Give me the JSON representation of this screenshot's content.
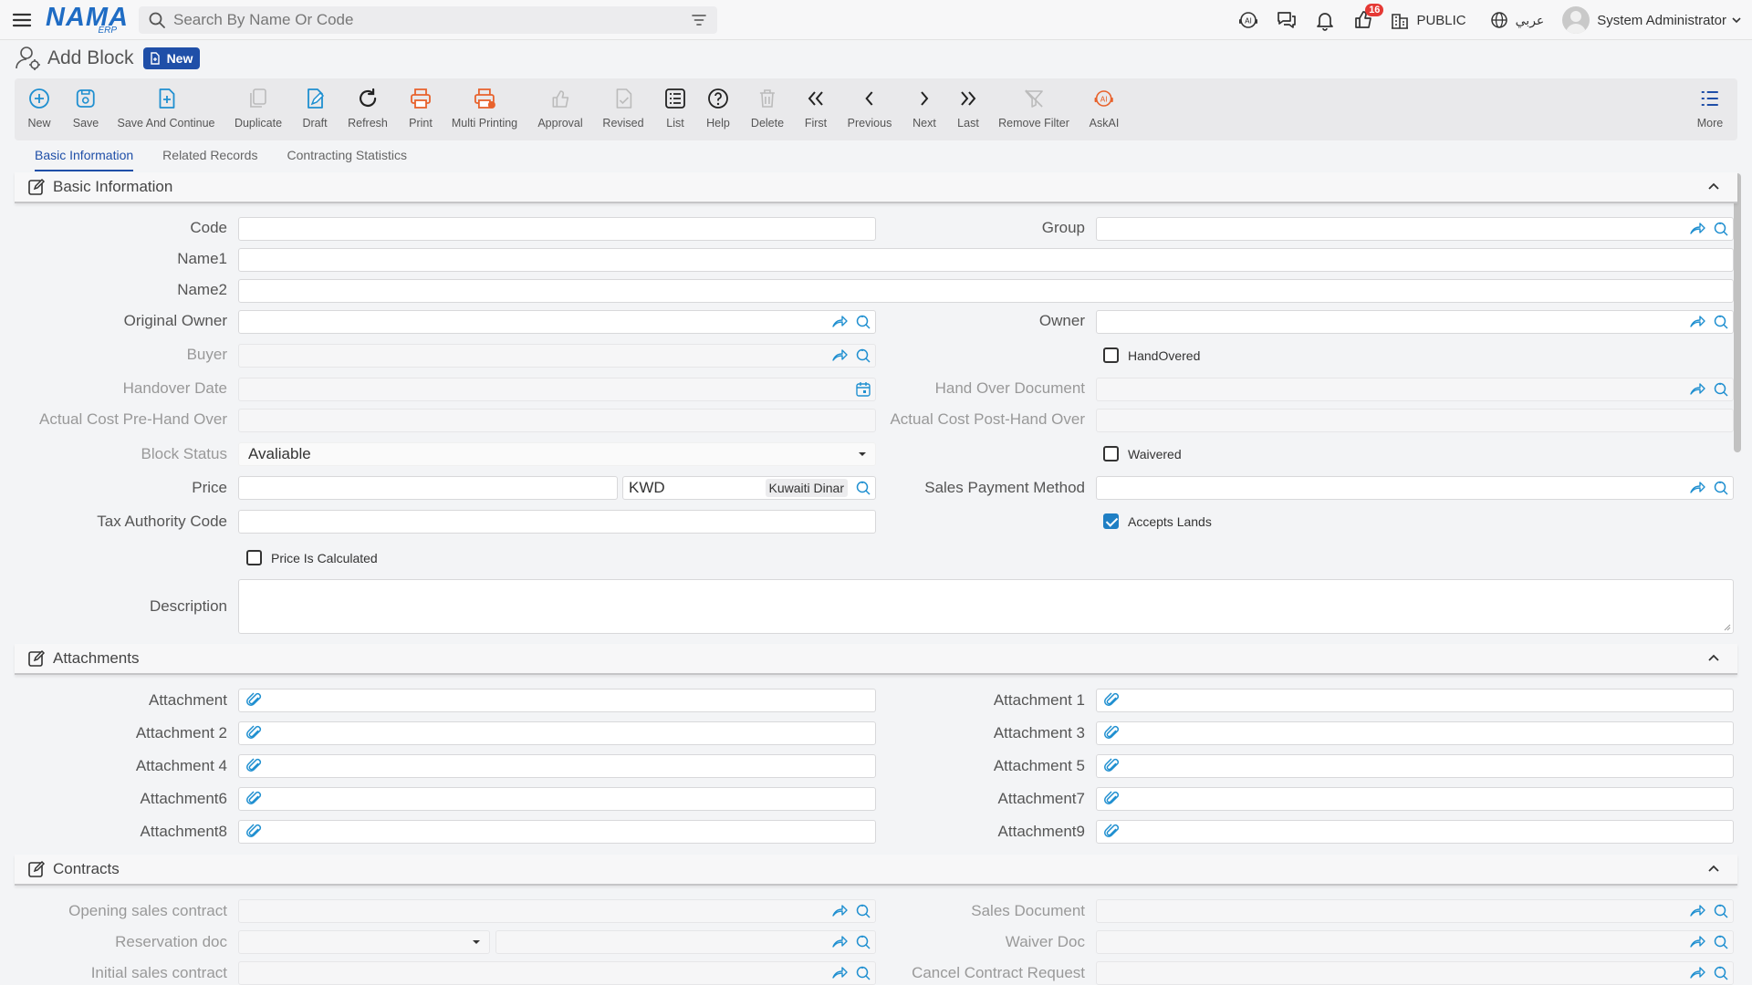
{
  "header": {
    "logo_main": "NAMA",
    "logo_sub": "ERP",
    "search_placeholder": "Search By Name Or Code",
    "notification_count": "16",
    "company": "PUBLIC",
    "language": "عربي",
    "user": "System Administrator"
  },
  "page": {
    "title": "Add Block",
    "status": "New"
  },
  "toolbar": [
    {
      "label": "New",
      "icon": "plus-circle-icon"
    },
    {
      "label": "Save",
      "icon": "save-icon"
    },
    {
      "label": "Save And Continue",
      "icon": "save-continue-icon"
    },
    {
      "label": "Duplicate",
      "icon": "duplicate-icon"
    },
    {
      "label": "Draft",
      "icon": "draft-icon"
    },
    {
      "label": "Refresh",
      "icon": "refresh-icon"
    },
    {
      "label": "Print",
      "icon": "print-icon"
    },
    {
      "label": "Multi Printing",
      "icon": "multi-print-icon"
    },
    {
      "label": "Approval",
      "icon": "approval-icon"
    },
    {
      "label": "Revised",
      "icon": "revised-icon"
    },
    {
      "label": "List",
      "icon": "list-icon"
    },
    {
      "label": "Help",
      "icon": "help-icon"
    },
    {
      "label": "Delete",
      "icon": "trash-icon"
    },
    {
      "label": "First",
      "icon": "first-icon"
    },
    {
      "label": "Previous",
      "icon": "previous-icon"
    },
    {
      "label": "Next",
      "icon": "next-icon"
    },
    {
      "label": "Last",
      "icon": "last-icon"
    },
    {
      "label": "Remove Filter",
      "icon": "remove-filter-icon"
    },
    {
      "label": "AskAI",
      "icon": "askai-icon"
    },
    {
      "label": "More",
      "icon": "more-icon"
    }
  ],
  "tabs": [
    {
      "label": "Basic Information",
      "active": true
    },
    {
      "label": "Related Records",
      "active": false
    },
    {
      "label": "Contracting Statistics",
      "active": false
    }
  ],
  "sections": {
    "basic": "Basic Information",
    "attachments": "Attachments",
    "contracts": "Contracts"
  },
  "basic_info": {
    "code": "Code",
    "group": "Group",
    "name1": "Name1",
    "name2": "Name2",
    "original_owner": "Original Owner",
    "owner": "Owner",
    "buyer": "Buyer",
    "handovered": "HandOvered",
    "handover_date": "Handover Date",
    "hand_over_document": "Hand Over Document",
    "actual_cost_pre": "Actual Cost Pre-Hand Over",
    "actual_cost_post": "Actual Cost Post-Hand Over",
    "block_status": "Block Status",
    "block_status_value": "Avaliable",
    "waivered": "Waivered",
    "price": "Price",
    "currency_code": "KWD",
    "currency_name": "Kuwaiti Dinar",
    "sales_payment_method": "Sales Payment Method",
    "tax_authority_code": "Tax Authority Code",
    "accepts_lands": "Accepts Lands",
    "price_is_calculated": "Price Is Calculated",
    "description": "Description"
  },
  "attachments": {
    "a0": "Attachment",
    "a1": "Attachment 1",
    "a2": "Attachment 2",
    "a3": "Attachment 3",
    "a4": "Attachment 4",
    "a5": "Attachment 5",
    "a6": "Attachment6",
    "a7": "Attachment7",
    "a8": "Attachment8",
    "a9": "Attachment9"
  },
  "contracts": {
    "opening_sales_contract": "Opening sales contract",
    "sales_document": "Sales Document",
    "reservation_doc": "Reservation doc",
    "waiver_doc": "Waiver Doc",
    "initial_sales_contract": "Initial sales contract",
    "cancel_contract_request": "Cancel Contract Request"
  },
  "colors": {
    "accent": "#1f4fa8",
    "icon_blue": "#1f8fd0",
    "orange": "#e8622c"
  }
}
